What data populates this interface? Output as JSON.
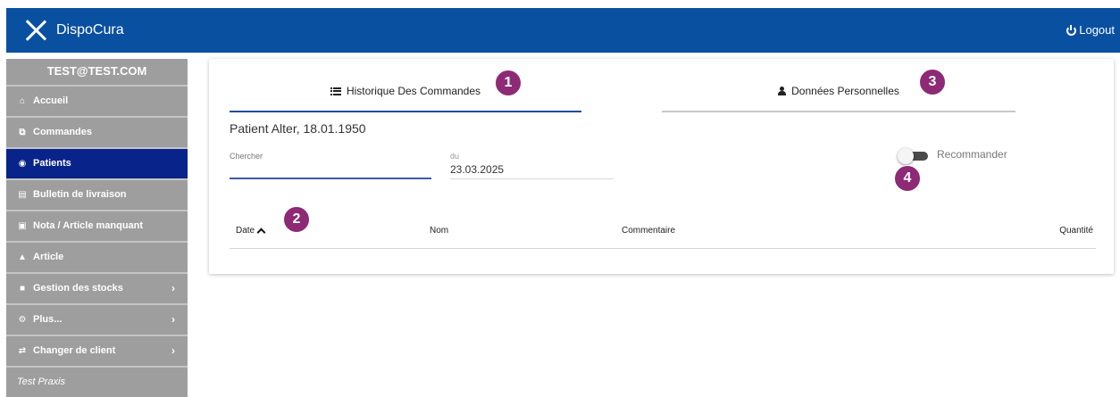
{
  "header": {
    "app_title": "DispoCura",
    "logout_label": "Logout",
    "brand_color": "#0a50a1"
  },
  "sidebar": {
    "user": "TEST@TEST.COM",
    "items": [
      {
        "label": "Accueil",
        "icon": "home-icon"
      },
      {
        "label": "Commandes",
        "icon": "copy-icon"
      },
      {
        "label": "Patients",
        "icon": "users-icon",
        "active": true
      },
      {
        "label": "Bulletin de livraison",
        "icon": "file-icon"
      },
      {
        "label": "Nota / Article manquant",
        "icon": "box-icon"
      },
      {
        "label": "Article",
        "icon": "cart-icon"
      },
      {
        "label": "Gestion des stocks",
        "icon": "stock-icon",
        "has_submenu": true
      },
      {
        "label": "Plus...",
        "icon": "gear-icon",
        "has_submenu": true
      },
      {
        "label": "Changer de client",
        "icon": "shuffle-icon",
        "has_submenu": true
      },
      {
        "label": "Test Praxis",
        "icon": "",
        "italic": true
      }
    ],
    "active_color": "#08238a"
  },
  "tabs": [
    {
      "label": "Historique Des Commandes",
      "icon": "list-icon",
      "active": true
    },
    {
      "label": "Données Personnelles",
      "icon": "person-icon",
      "active": false
    }
  ],
  "patient": {
    "title": "Patient Alter, 18.01.1950"
  },
  "filters": {
    "search_label": "Chercher",
    "search_value": "",
    "date_label": "du",
    "date_value": "23.03.2025",
    "toggle_label": "Recommander",
    "toggle_on": false
  },
  "table": {
    "columns": [
      "Date",
      "Nom",
      "Commentaire",
      "Quantité"
    ],
    "sort_column": "Date",
    "sort_direction": "asc",
    "rows": []
  },
  "annotations": [
    "1",
    "2",
    "3",
    "4"
  ],
  "annotation_color": "#8e2975"
}
